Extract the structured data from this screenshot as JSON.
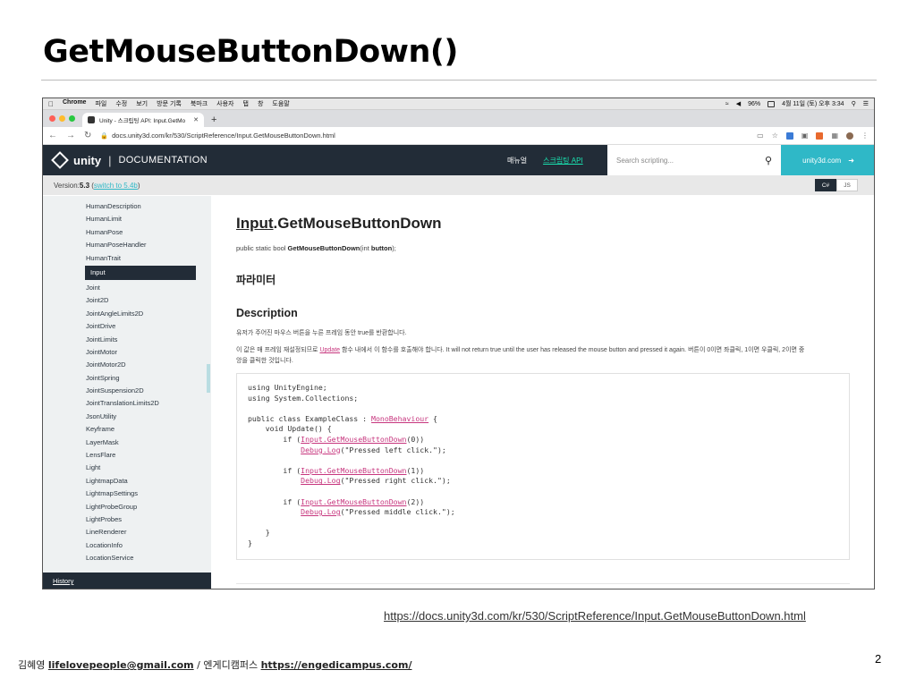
{
  "slide": {
    "title": "GetMouseButtonDown()",
    "source_url": "https://docs.unity3d.com/kr/530/ScriptReference/Input.GetMouseButtonDown.html",
    "footer_author": "김혜영",
    "footer_email": "lifelovepeople@gmail.com",
    "footer_sep": "/",
    "footer_org": "엔게디캠퍼스",
    "footer_site": "https://engedicampus.com/",
    "page_number": "2"
  },
  "macbar": {
    "menus": [
      "Chrome",
      "파일",
      "수정",
      "보기",
      "방문 기록",
      "북마크",
      "사용자",
      "탭",
      "창",
      "도움말"
    ],
    "battery": "96%",
    "datetime": "4월 11일 (토) 오후 3:34"
  },
  "browser": {
    "tab_title": "Unity - 스크립팅 API: Input.GetMo",
    "url": "docs.unity3d.com/kr/530/ScriptReference/Input.GetMouseButtonDown.html"
  },
  "unity_header": {
    "logo_text": "unity",
    "section": "DOCUMENTATION",
    "nav_manual": "매뉴얼",
    "nav_scripting": "스크립팅 API",
    "search_placeholder": "Search scripting...",
    "site_link": "unity3d.com"
  },
  "version_bar": {
    "prefix": "Version: ",
    "version": "5.3",
    "switch_link": "switch to 5.4b",
    "lang_cs": "C#",
    "lang_js": "JS"
  },
  "sidebar": {
    "items": [
      "HumanDescription",
      "HumanLimit",
      "HumanPose",
      "HumanPoseHandler",
      "HumanTrait",
      "Input",
      "Joint",
      "Joint2D",
      "JointAngleLimits2D",
      "JointDrive",
      "JointLimits",
      "JointMotor",
      "JointMotor2D",
      "JointSpring",
      "JointSuspension2D",
      "JointTranslationLimits2D",
      "JsonUtility",
      "Keyframe",
      "LayerMask",
      "LensFlare",
      "Light",
      "LightmapData",
      "LightmapSettings",
      "LightProbeGroup",
      "LightProbes",
      "LineRenderer",
      "LocationInfo",
      "LocationService"
    ],
    "active_index": 5,
    "history": "History"
  },
  "content": {
    "title_class": "Input",
    "title_method": ".GetMouseButtonDown",
    "sig_prefix": "public static bool ",
    "sig_method": "GetMouseButtonDown",
    "sig_open": "(int ",
    "sig_param": "button",
    "sig_close": ");",
    "params_heading": "파라미터",
    "desc_heading": "Description",
    "desc1": "유저가 주어진 마우스 버튼을 누른 프레임 동안 true를 반환합니다.",
    "desc2_a": "이 값은 매 프레임 재설정되므로 ",
    "desc2_link": "Update",
    "desc2_b": " 함수 내에서 이 함수를 호출해야 합니다. It will not return true until the user has released the mouse button and pressed it again. 버튼이 0이면 좌클릭, 1이면 우클릭, 2이면 중앙을 클릭한 것입니다.",
    "code": {
      "l1": "using UnityEngine;",
      "l2": "using System.Collections;",
      "l3a": "public class ExampleClass : ",
      "l3link": "MonoBehaviour",
      "l3b": " {",
      "l4": "    void Update() {",
      "if_prefix": "        if (",
      "input_call": "Input.GetMouseButtonDown",
      "arg0": "(0))",
      "arg1": "(1))",
      "arg2": "(2))",
      "log_indent": "            ",
      "log_call": "Debug.Log",
      "log0": "(\"Pressed left click.\");",
      "log1": "(\"Pressed right click.\");",
      "log2": "(\"Pressed middle click.\");",
      "close_inner": "    }",
      "close_outer": "}"
    }
  },
  "colors": {
    "unity_dark": "#222c37",
    "unity_teal": "#2fb8c7",
    "nav_active": "#19e3b1",
    "link_pink": "#c7367e"
  }
}
